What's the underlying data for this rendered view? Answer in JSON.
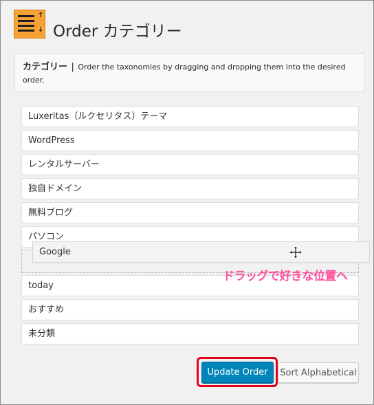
{
  "header": {
    "title": "Order カテゴリー",
    "icon": "sort-list-icon",
    "icon_color": "#f7a235"
  },
  "description": {
    "title": "カテゴリー",
    "separator": "|",
    "text": "Order the taxonomies by dragging and dropping them into the desired order."
  },
  "list": {
    "items_above": [
      {
        "label": "Luxeritas（ルクセリタス）テーマ"
      },
      {
        "label": "WordPress"
      },
      {
        "label": "レンタルサーバー"
      },
      {
        "label": "独自ドメイン"
      },
      {
        "label": "無料ブログ"
      },
      {
        "label": "パソコン"
      }
    ],
    "dragging_item": {
      "label": "Google"
    },
    "items_below": [
      {
        "label": "today"
      },
      {
        "label": "おすすめ"
      },
      {
        "label": "未分類"
      }
    ]
  },
  "annotation": {
    "text": "ドラッグで好きな位置へ",
    "color": "#ff4f9e"
  },
  "buttons": {
    "update_label": "Update Order",
    "sort_label": "Sort Alphabetical",
    "primary_color": "#0085ba",
    "highlight_color": "#e3001b"
  }
}
